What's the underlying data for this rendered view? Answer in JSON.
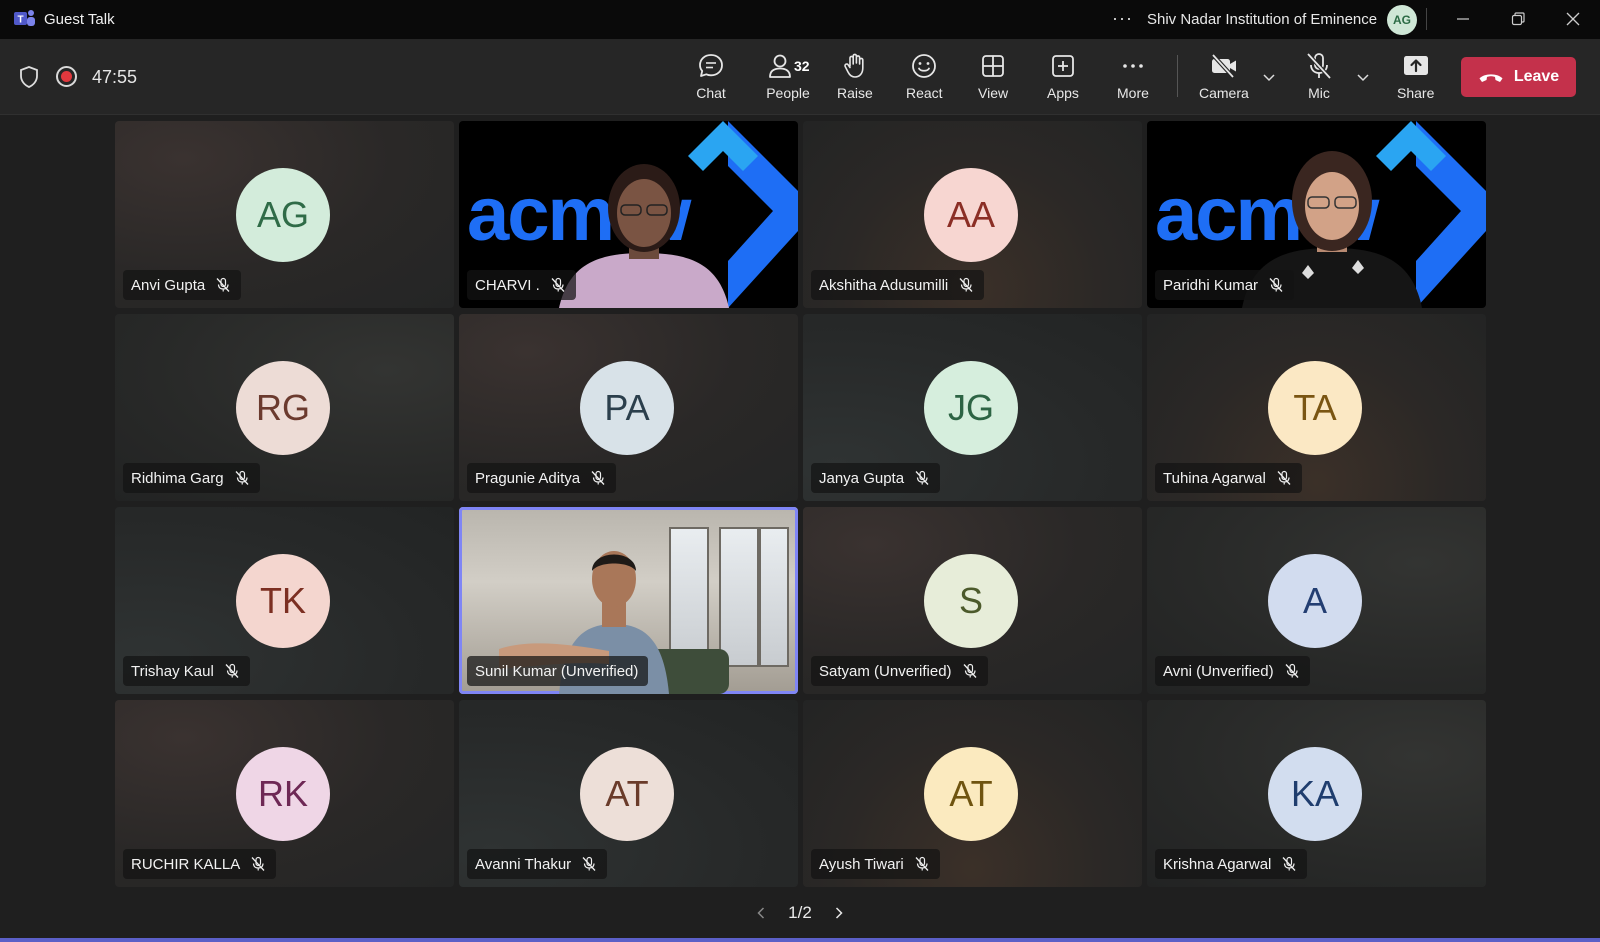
{
  "window": {
    "title": "Guest Talk",
    "more_label": "···",
    "org": "Shiv Nadar Institution of Eminence",
    "user_initials": "AG"
  },
  "meeting": {
    "timer": "47:55"
  },
  "toolbar": {
    "chat": "Chat",
    "people": "People",
    "people_count": "32",
    "raise": "Raise",
    "react": "React",
    "view": "View",
    "apps": "Apps",
    "more": "More",
    "camera": "Camera",
    "mic": "Mic",
    "share": "Share",
    "leave": "Leave"
  },
  "participants": [
    {
      "name": "Anvi Gupta",
      "initials": "AG",
      "bg": "#d3ecdb",
      "fg": "#2f6b47"
    },
    {
      "name": "CHARVI .",
      "video": "acm"
    },
    {
      "name": "Akshitha Adusumilli",
      "initials": "AA",
      "bg": "#f7d6d1",
      "fg": "#8b2e25"
    },
    {
      "name": "Paridhi Kumar",
      "video": "acm"
    },
    {
      "name": "Ridhima Garg",
      "initials": "RG",
      "bg": "#eddcd6",
      "fg": "#6b3a2e"
    },
    {
      "name": "Pragunie Aditya",
      "initials": "PA",
      "bg": "#d8e2e8",
      "fg": "#2b3f4c"
    },
    {
      "name": "Janya Gupta",
      "initials": "JG",
      "bg": "#d6eedd",
      "fg": "#2d6444"
    },
    {
      "name": "Tuhina Agarwal",
      "initials": "TA",
      "bg": "#fbe8c4",
      "fg": "#7a5512"
    },
    {
      "name": "Trishay Kaul",
      "initials": "TK",
      "bg": "#f4d6cf",
      "fg": "#7c2f22"
    },
    {
      "name": "Sunil Kumar (Unverified)",
      "video": "room"
    },
    {
      "name": "Satyam (Unverified)",
      "initials": "S",
      "bg": "#e7edd9",
      "fg": "#4c5a2b"
    },
    {
      "name": "Avni (Unverified)",
      "initials": "A",
      "bg": "#d2dcef",
      "fg": "#233e72"
    },
    {
      "name": "RUCHIR KALLA",
      "initials": "RK",
      "bg": "#efd6e6",
      "fg": "#6e2855"
    },
    {
      "name": "Avanni Thakur",
      "initials": "AT",
      "bg": "#eddfd8",
      "fg": "#6a3b2a"
    },
    {
      "name": "Ayush Tiwari",
      "initials": "AT",
      "bg": "#fbeabf",
      "fg": "#6f5410"
    },
    {
      "name": "Krishna Agarwal",
      "initials": "KA",
      "bg": "#d2ddef",
      "fg": "#1f3d6e"
    }
  ],
  "pager": {
    "label": "1/2"
  },
  "colors": {
    "accent": "#5b5fc7",
    "leave": "#c4314b",
    "acm_blue": "#1e6ef5"
  }
}
